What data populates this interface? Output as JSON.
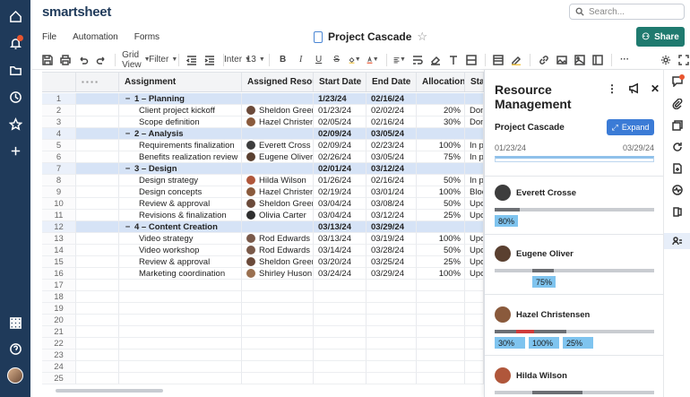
{
  "header": {
    "logo": "smartsheet",
    "search_placeholder": "Search...",
    "menus": [
      "File",
      "Automation",
      "Forms"
    ],
    "sheet_title": "Project Cascade",
    "share_label": "Share"
  },
  "toolbar": {
    "grid_view": "Grid View",
    "filter": "Filter",
    "font": "Inter",
    "font_size": "13"
  },
  "grid": {
    "headers": [
      "Assignment",
      "Assigned Resource",
      "Start Date",
      "End Date",
      "Allocation %",
      "Status"
    ],
    "rows": [
      {
        "n": "1",
        "section": true,
        "assignment": "1 – Planning",
        "resource": "",
        "start": "1/23/24",
        "end": "02/16/24",
        "alloc": "",
        "status": ""
      },
      {
        "n": "2",
        "assignment": "Client project kickoff",
        "resource": "Sheldon Greene",
        "start": "01/23/24",
        "end": "02/02/24",
        "alloc": "20%",
        "status": "Done",
        "av": "#6b4a3a"
      },
      {
        "n": "3",
        "assignment": "Scope definition",
        "resource": "Hazel Christensen",
        "start": "02/05/24",
        "end": "02/16/24",
        "alloc": "30%",
        "status": "Done",
        "av": "#8a5a3c"
      },
      {
        "n": "4",
        "section": true,
        "assignment": "2 – Analysis",
        "resource": "",
        "start": "02/09/24",
        "end": "03/05/24",
        "alloc": "",
        "status": ""
      },
      {
        "n": "5",
        "assignment": "Requirements finalization",
        "resource": "Everett Cross",
        "start": "02/09/24",
        "end": "02/23/24",
        "alloc": "100%",
        "status": "In pr",
        "av": "#3d3d3d"
      },
      {
        "n": "6",
        "assignment": "Benefits realization review",
        "resource": "Eugene Oliver",
        "start": "02/26/24",
        "end": "03/05/24",
        "alloc": "75%",
        "status": "In pr",
        "av": "#5a4030"
      },
      {
        "n": "7",
        "section": true,
        "assignment": "3 – Design",
        "resource": "",
        "start": "02/01/24",
        "end": "03/12/24",
        "alloc": "",
        "status": ""
      },
      {
        "n": "8",
        "assignment": "Design strategy",
        "resource": "Hilda Wilson",
        "start": "01/26/24",
        "end": "02/16/24",
        "alloc": "50%",
        "status": "In pro",
        "av": "#b0573b"
      },
      {
        "n": "9",
        "assignment": "Design concepts",
        "resource": "Hazel Christensen",
        "start": "02/19/24",
        "end": "03/01/24",
        "alloc": "100%",
        "status": "Block",
        "av": "#8a5a3c"
      },
      {
        "n": "10",
        "assignment": "Review & approval",
        "resource": "Sheldon Greene",
        "start": "03/04/24",
        "end": "03/08/24",
        "alloc": "50%",
        "status": "Upco",
        "av": "#6b4a3a"
      },
      {
        "n": "11",
        "assignment": "Revisions & finalization",
        "resource": "Olivia Carter",
        "start": "03/04/24",
        "end": "03/12/24",
        "alloc": "25%",
        "status": "Upco",
        "av": "#2f2f2f"
      },
      {
        "n": "12",
        "section": true,
        "assignment": "4 – Content Creation",
        "resource": "",
        "start": "03/13/24",
        "end": "03/29/24",
        "alloc": "",
        "status": ""
      },
      {
        "n": "13",
        "assignment": "Video strategy",
        "resource": "Rod Edwards",
        "start": "03/13/24",
        "end": "03/19/24",
        "alloc": "100%",
        "status": "Upco",
        "av": "#7a5a4a"
      },
      {
        "n": "14",
        "assignment": "Video workshop",
        "resource": "Rod Edwards",
        "start": "03/14/24",
        "end": "03/28/24",
        "alloc": "50%",
        "status": "Upco",
        "av": "#7a5a4a"
      },
      {
        "n": "15",
        "assignment": "Review & approval",
        "resource": "Sheldon Greene",
        "start": "03/20/24",
        "end": "03/25/24",
        "alloc": "25%",
        "status": "Upco",
        "av": "#6b4a3a"
      },
      {
        "n": "16",
        "assignment": "Marketing coordination",
        "resource": "Shirley Huson",
        "start": "03/24/24",
        "end": "03/29/24",
        "alloc": "100%",
        "status": "Upco",
        "av": "#9a7050"
      },
      {
        "n": "17"
      },
      {
        "n": "18"
      },
      {
        "n": "19"
      },
      {
        "n": "20"
      },
      {
        "n": "21"
      },
      {
        "n": "22"
      },
      {
        "n": "23"
      },
      {
        "n": "24"
      },
      {
        "n": "25"
      }
    ]
  },
  "panel": {
    "title": "Resource Management",
    "subtitle": "Project Cascade",
    "expand_label": "Expand",
    "date_start": "01/23/24",
    "date_end": "03/29/24",
    "people": [
      {
        "name": "Everett Crosse",
        "av": "#3d3d3d",
        "chips": [
          "80%"
        ]
      },
      {
        "name": "Eugene Oliver",
        "av": "#5a4030",
        "chips": [
          "75%"
        ]
      },
      {
        "name": "Hazel Christensen",
        "av": "#8a5a3c",
        "chips": [
          "30%",
          "100%",
          "25%"
        ]
      },
      {
        "name": "Hilda Wilson",
        "av": "#b0573b",
        "chips": []
      }
    ]
  }
}
